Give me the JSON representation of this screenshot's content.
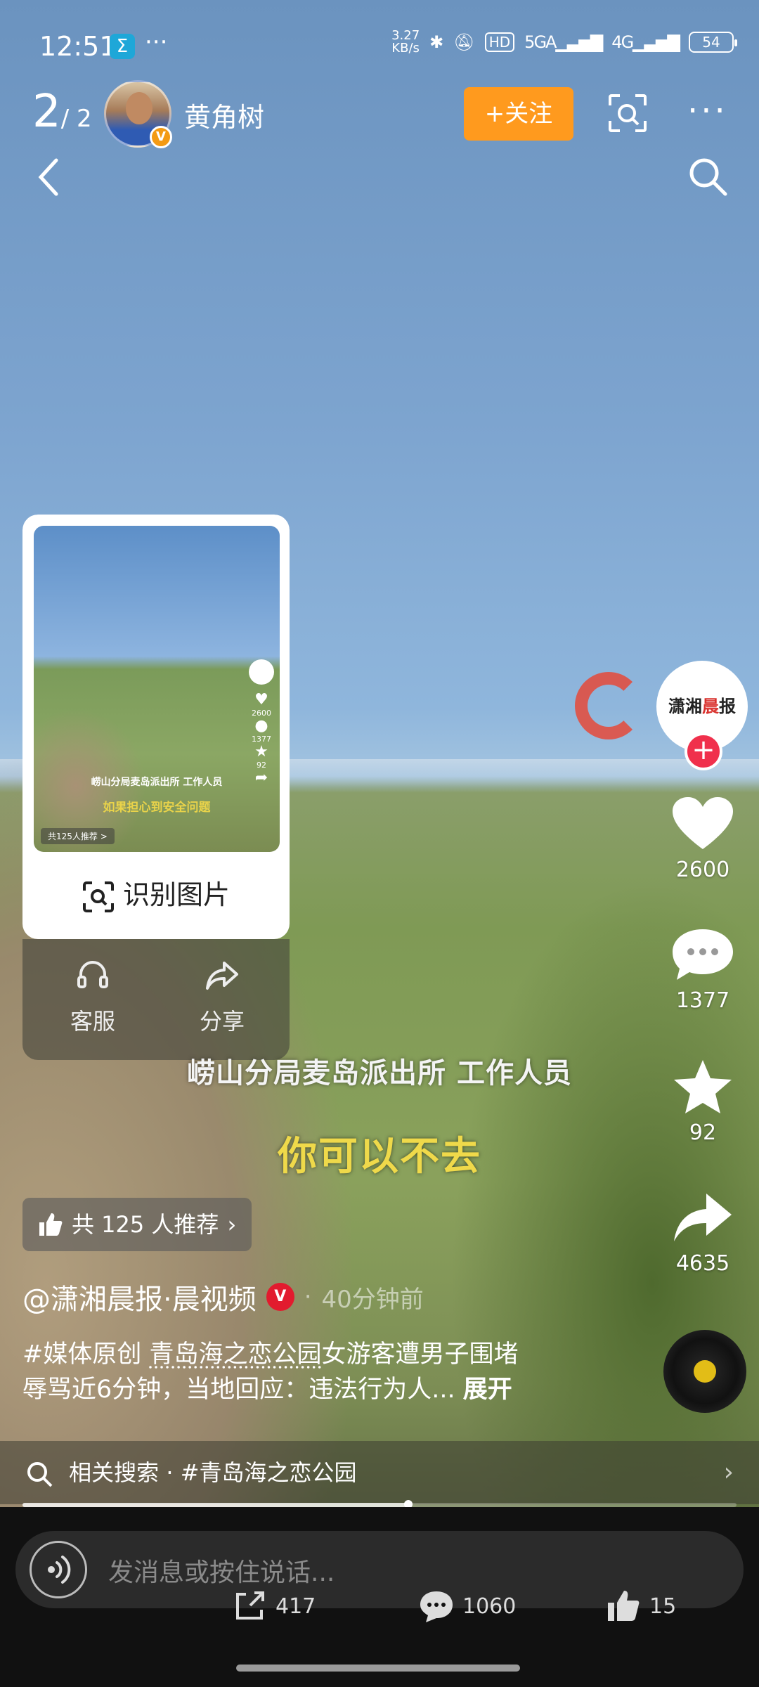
{
  "status_bar": {
    "time": "12:51",
    "app_badge": "Σ",
    "overflow": "···",
    "net_speed_value": "3.27",
    "net_speed_unit": "KB/s",
    "hd_label": "HD",
    "sig1_label": "5GA",
    "sig2_label": "4G",
    "battery": "54"
  },
  "top_bar": {
    "page_current": "2",
    "page_total": "/ 2",
    "author_name": "黄角树",
    "follow_label": "+关注"
  },
  "popup_card": {
    "thumb_subtitle_1": "崂山分局麦岛派出所 工作人员",
    "thumb_subtitle_2": "如果担心到安全问题",
    "thumb_pill": "共125人推荐 >",
    "thumb_counts": [
      "2600",
      "1377",
      "92"
    ],
    "recognize_label": "识别图片",
    "service_label": "客服",
    "share_label": "分享"
  },
  "video": {
    "subtitle_1": "崂山分局麦岛派出所 工作人员",
    "subtitle_2": "你可以不去"
  },
  "side_rail": {
    "channel_logo": [
      "潇湘",
      "晨",
      "报"
    ],
    "likes": "2600",
    "comments": "1377",
    "favorites": "92",
    "shares": "4635"
  },
  "recommend_pill": "共 125 人推荐",
  "author_line": {
    "name": "@潇湘晨报·晨视频",
    "verified": "V",
    "separator": "·",
    "time": "40分钟前"
  },
  "description": {
    "tag": "#媒体原创",
    "place": "青岛海之恋公园",
    "text_1": "女游客遭男子围堵",
    "text_2": "辱骂近6分钟，当地回应：违法行为人...",
    "expand": "展开"
  },
  "related_search": {
    "label": "相关搜索",
    "separator": "·",
    "query": "#青岛海之恋公园"
  },
  "progress_fraction": 0.54,
  "bottom_bar": {
    "placeholder": "发消息或按住说话...",
    "share_count": "417",
    "comment_count": "1060",
    "like_count": "15"
  }
}
